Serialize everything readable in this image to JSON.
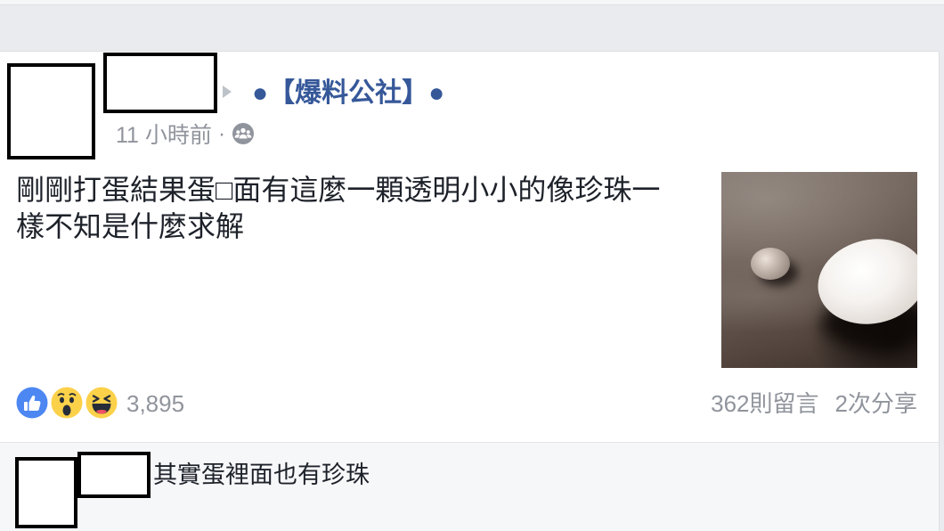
{
  "colors": {
    "link": "#365899",
    "secondary": "#90949c",
    "primary": "#1d2129",
    "page_bg": "#e9ebee",
    "comment_bg": "#f6f7f9",
    "like": "#4c87f2",
    "reaction": "#fcd14a"
  },
  "post": {
    "header": {
      "icons": {
        "arrow": "caret-right-icon",
        "audience": "group-members-icon"
      },
      "group_name": "●【爆料公社】●",
      "timestamp": "11 小時前",
      "separator": "·"
    },
    "text": "剛剛打蛋結果蛋□面有這麼一顆透明小小的像珍珠一樣不知是什麼求解",
    "reactions": {
      "icons": [
        "like-icon",
        "wow-icon",
        "haha-icon"
      ],
      "count": "3,895"
    },
    "stats": {
      "comments": "362則留言",
      "shares": "2次分享"
    }
  },
  "comments": [
    {
      "text": "其實蛋裡面也有珍珠"
    }
  ]
}
